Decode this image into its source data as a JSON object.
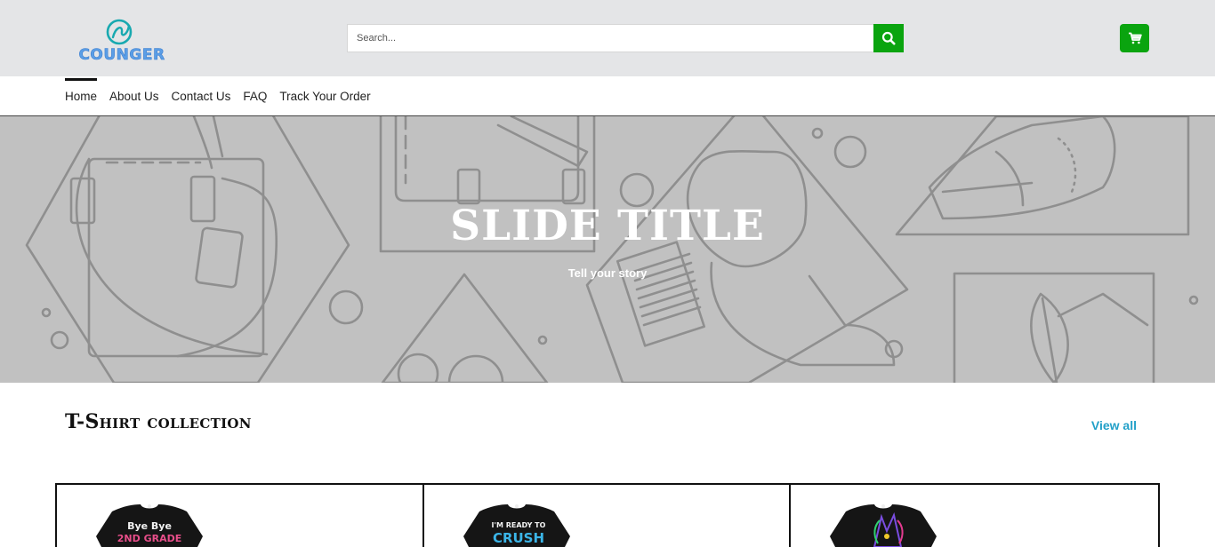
{
  "header": {
    "logo_text": "COUNGER",
    "search": {
      "placeholder": "Search...",
      "value": ""
    },
    "search_icon": "search-icon",
    "cart_icon": "cart-icon"
  },
  "nav": {
    "items": [
      {
        "label": "Home",
        "active": true
      },
      {
        "label": "About Us",
        "active": false
      },
      {
        "label": "Contact Us",
        "active": false
      },
      {
        "label": "FAQ",
        "active": false
      },
      {
        "label": "Track Your Order",
        "active": false
      }
    ]
  },
  "hero": {
    "title": "SLIDE TITLE",
    "subtitle": "Tell your story"
  },
  "collection": {
    "title": "T-Shirt collection",
    "view_all": "View all",
    "products": [
      {
        "name": "Bye Bye 2nd Grade shirt",
        "print": "Bye Bye 2ND GRADE"
      },
      {
        "name": "I'm Ready To Crush shirt",
        "print": "I'M READY TO CRUSH"
      },
      {
        "name": "Unicorn shirt",
        "print": ""
      }
    ]
  },
  "colors": {
    "accent_green": "#0aa40f",
    "link_blue": "#22a0c8",
    "header_bg": "#e4e5e7",
    "hero_bg": "#c1c1c1"
  }
}
